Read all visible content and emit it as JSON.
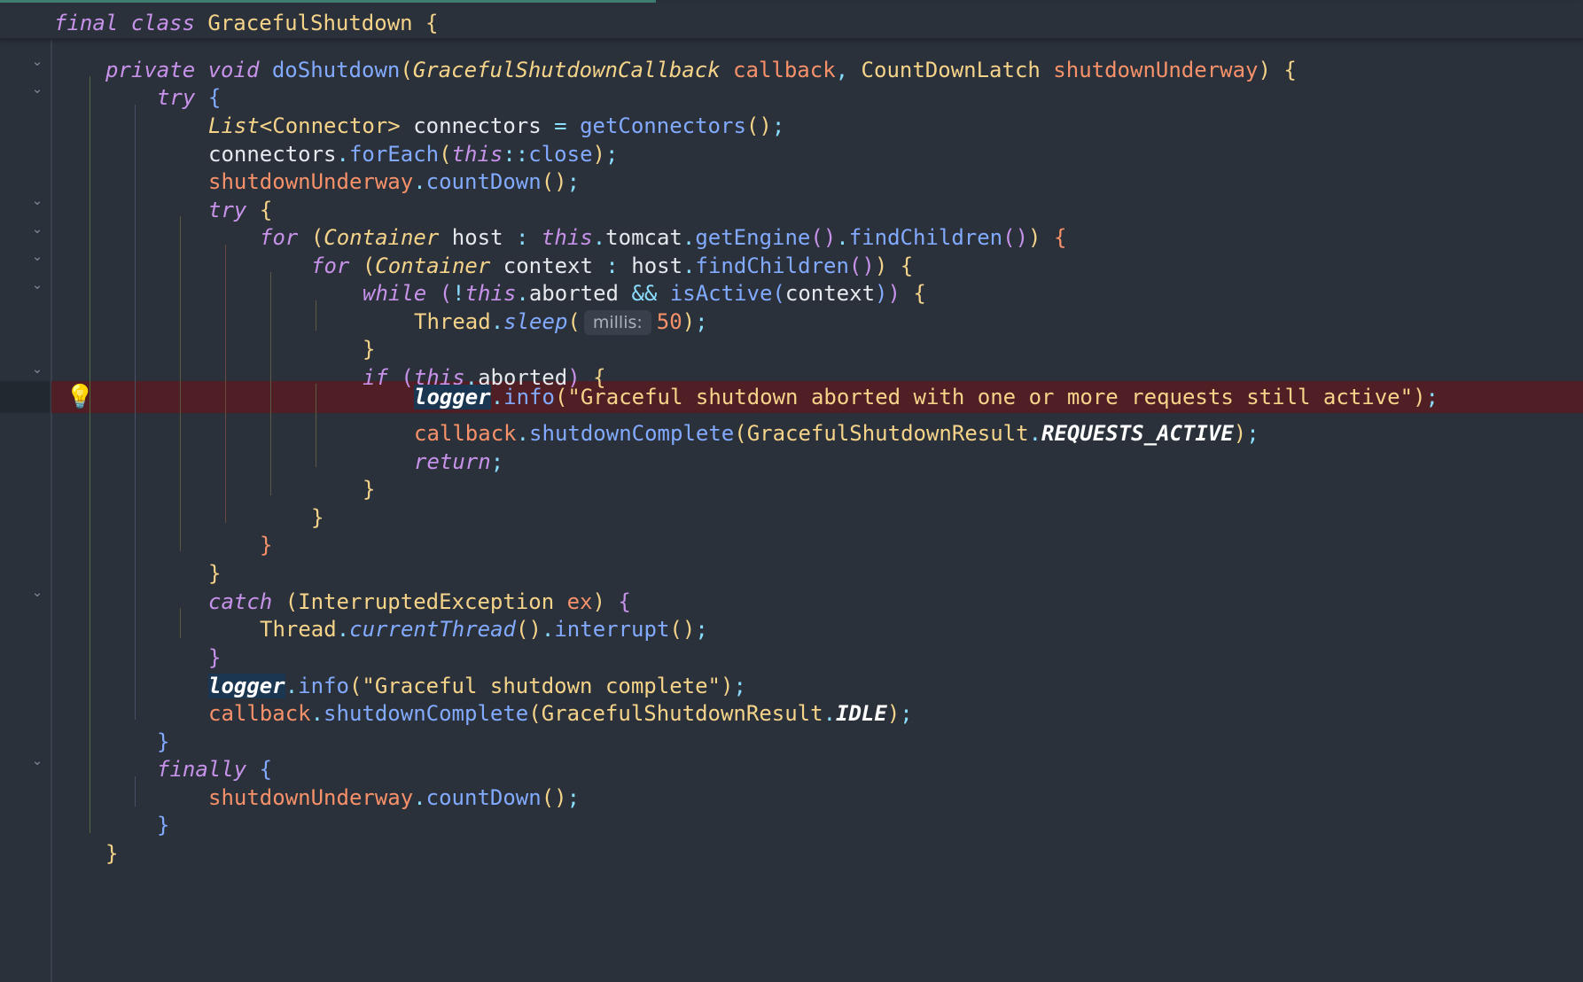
{
  "editor": {
    "sticky_header": {
      "keyword_final": "final",
      "keyword_class": "class",
      "class_name": "GracefulShutdown",
      "brace": "{"
    },
    "colors": {
      "background": "#2b313a",
      "highlight_line": "#4f1f25",
      "keyword": "#c792ea",
      "type": "#f5d48a",
      "function": "#82aaff",
      "parameter": "#f7916a",
      "logger_background": "#1b3650",
      "bulb": "#f7c948"
    },
    "icons": {
      "fold": "chevron-down-icon",
      "intention": "lightbulb-icon"
    },
    "parameter_hint": "millis:"
  }
}
